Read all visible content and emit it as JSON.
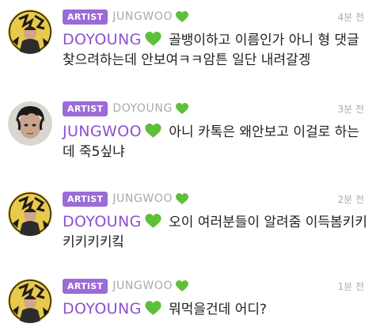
{
  "colors": {
    "accent": "#9b6bd6",
    "mention": "#8e4fd1",
    "heart": "#5fbf3a",
    "muted": "#a9a9a9"
  },
  "comments": [
    {
      "badge": "ARTIST",
      "author": "JUNGWOO",
      "author_icon": "green-heart-icon",
      "time": "4분 전",
      "mention": "DOYOUNG",
      "mention_icon": "green-heart-icon",
      "text": "골뱅이하고 이름인가 아니 형 댓글 찾으려하는데 안보여ㅋㅋ암튼 일단 내려갈겡"
    },
    {
      "badge": "ARTIST",
      "author": "DOYOUNG",
      "author_icon": "green-heart-icon",
      "time": "3분 전",
      "mention": "JUNGWOO",
      "mention_icon": "green-heart-icon",
      "text": "아니 카톡은 왜안보고 이걸로 하는데 죽5싶냐"
    },
    {
      "badge": "ARTIST",
      "author": "JUNGWOO",
      "author_icon": "green-heart-icon",
      "time": "2분 전",
      "mention": "DOYOUNG",
      "mention_icon": "green-heart-icon",
      "text": "오이 여러분들이 알려줌 이득봄키키키키키키킼"
    },
    {
      "badge": "ARTIST",
      "author": "JUNGWOO",
      "author_icon": "green-heart-icon",
      "time": "1분 전",
      "mention": "DOYOUNG",
      "mention_icon": "green-heart-icon",
      "text": "뭐먹을건데 어디?"
    }
  ]
}
